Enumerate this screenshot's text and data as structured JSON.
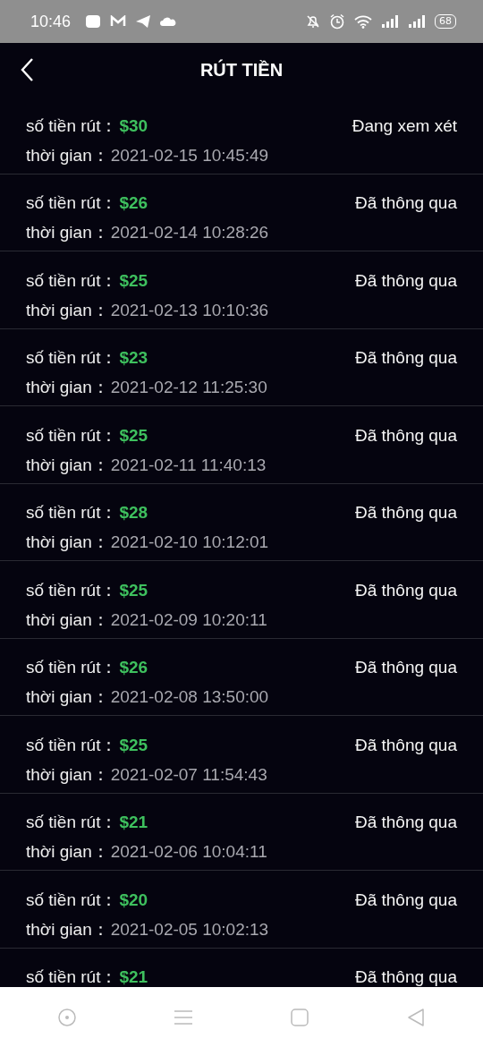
{
  "status_bar": {
    "time": "10:46",
    "battery": "68"
  },
  "header": {
    "title": "RÚT TIỀN"
  },
  "records": [
    {
      "amount_label": "số tiền rút：",
      "amount": "$30",
      "status": "Đang xem xét",
      "time_label": "thời gian：",
      "time": "2021-02-15 10:45:49"
    },
    {
      "amount_label": "số tiền rút：",
      "amount": "$26",
      "status": "Đã thông qua",
      "time_label": "thời gian：",
      "time": "2021-02-14 10:28:26"
    },
    {
      "amount_label": "số tiền rút：",
      "amount": "$25",
      "status": "Đã thông qua",
      "time_label": "thời gian：",
      "time": "2021-02-13 10:10:36"
    },
    {
      "amount_label": "số tiền rút：",
      "amount": "$23",
      "status": "Đã thông qua",
      "time_label": "thời gian：",
      "time": "2021-02-12 11:25:30"
    },
    {
      "amount_label": "số tiền rút：",
      "amount": "$25",
      "status": "Đã thông qua",
      "time_label": "thời gian：",
      "time": "2021-02-11 11:40:13"
    },
    {
      "amount_label": "số tiền rút：",
      "amount": "$28",
      "status": "Đã thông qua",
      "time_label": "thời gian：",
      "time": "2021-02-10 10:12:01"
    },
    {
      "amount_label": "số tiền rút：",
      "amount": "$25",
      "status": "Đã thông qua",
      "time_label": "thời gian：",
      "time": "2021-02-09 10:20:11"
    },
    {
      "amount_label": "số tiền rút：",
      "amount": "$26",
      "status": "Đã thông qua",
      "time_label": "thời gian：",
      "time": "2021-02-08 13:50:00"
    },
    {
      "amount_label": "số tiền rút：",
      "amount": "$25",
      "status": "Đã thông qua",
      "time_label": "thời gian：",
      "time": "2021-02-07 11:54:43"
    },
    {
      "amount_label": "số tiền rút：",
      "amount": "$21",
      "status": "Đã thông qua",
      "time_label": "thời gian：",
      "time": "2021-02-06 10:04:11"
    },
    {
      "amount_label": "số tiền rút：",
      "amount": "$20",
      "status": "Đã thông qua",
      "time_label": "thời gian：",
      "time": "2021-02-05 10:02:13"
    },
    {
      "amount_label": "số tiền rút：",
      "amount": "$21",
      "status": "Đã thông qua"
    }
  ]
}
